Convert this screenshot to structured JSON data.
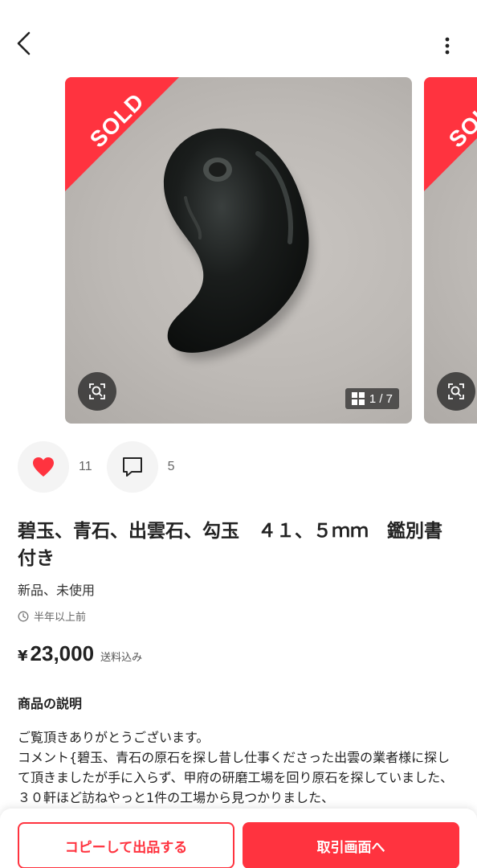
{
  "nav": {
    "back_icon": "chevron-left-icon",
    "more_icon": "vertical-dots-icon"
  },
  "gallery": {
    "sold_label": "SOLD",
    "counter": "1 / 7",
    "lens_icon": "image-search-icon",
    "grid_icon": "grid-icon"
  },
  "reactions": {
    "like_count": "11",
    "comment_count": "5",
    "like_icon": "heart-icon",
    "comment_icon": "comment-icon"
  },
  "item": {
    "title": "碧玉、青石、出雲石、勾玉　４１、５ｍｍ　鑑別書付き",
    "condition": "新品、未使用",
    "posted": "半年以上前",
    "currency": "¥",
    "price": "23,000",
    "shipping": "送料込み"
  },
  "description": {
    "heading": "商品の説明",
    "line1": "ご覧頂きありがとうございます。",
    "line2": "コメント{碧玉、青石の原石を探し昔し仕事くださった出雲の業者様に探して頂きましたが手に入らず、甲府の研磨工場を回り原石を探していました、３０軒ほど訪ねやっと1件の工場から見つかりました、"
  },
  "actions": {
    "copy_label": "コピーして出品する",
    "trade_label": "取引画面へ"
  },
  "colors": {
    "accent": "#ff333f"
  }
}
